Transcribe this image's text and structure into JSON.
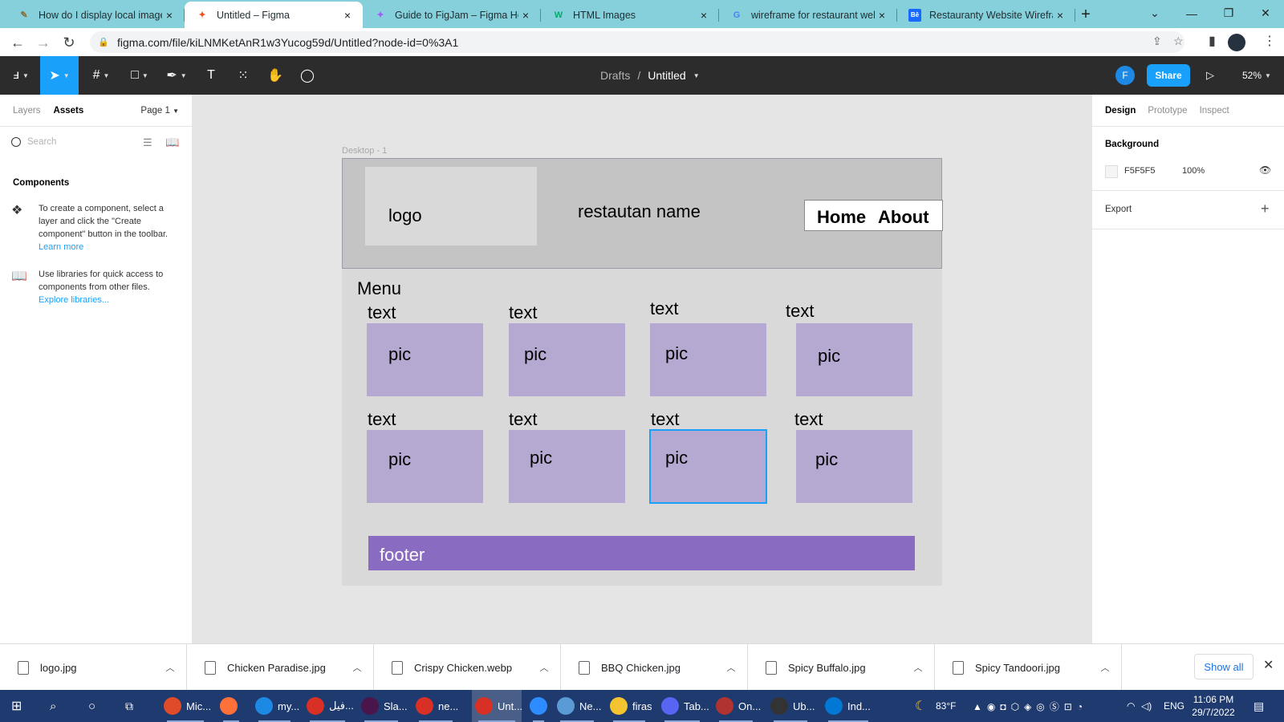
{
  "browser": {
    "tabs": [
      {
        "title": "How do I display local image",
        "favicon": "doc-icon"
      },
      {
        "title": "Untitled – Figma",
        "favicon": "figma-icon",
        "active": true
      },
      {
        "title": "Guide to FigJam – Figma Help",
        "favicon": "figma-icon"
      },
      {
        "title": "HTML Images",
        "favicon": "w3schools-icon"
      },
      {
        "title": "wireframe for restaurant web",
        "favicon": "google-icon"
      },
      {
        "title": "Restauranty Website Wirefran",
        "favicon": "behance-icon"
      }
    ],
    "url": "figma.com/file/kiLNMKetAnR1w3Yucog59d/Untitled?node-id=0%3A1"
  },
  "figma_toolbar": {
    "breadcrumb_parent": "Drafts",
    "breadcrumb_sep": "/",
    "file_name": "Untitled",
    "avatar_letter": "F",
    "share_label": "Share",
    "zoom": "52%"
  },
  "left_panel": {
    "tabs": [
      "Layers",
      "Assets"
    ],
    "active_tab": "Assets",
    "page_selector": "Page 1",
    "search_placeholder": "Search",
    "components_heading": "Components",
    "info1": "To create a component, select a layer and click the \"Create component\" button in the toolbar.",
    "info1_link": "Learn more",
    "info2": "Use libraries for quick access to components from other files.",
    "info2_link": "Explore libraries..."
  },
  "canvas": {
    "frame_label": "Desktop - 1",
    "logo": "logo",
    "restaurant_name": "restautan name",
    "nav": [
      "Home",
      "About"
    ],
    "menu_heading": "Menu",
    "item_text": [
      "text",
      "text",
      "text",
      "text",
      "text",
      "text",
      "text",
      "text"
    ],
    "item_pic": [
      "pic",
      "pic",
      "pic",
      "pic",
      "pic",
      "pic",
      "pic",
      "pic"
    ],
    "footer": "footer",
    "help": "?"
  },
  "right_panel": {
    "tabs": [
      "Design",
      "Prototype",
      "Inspect"
    ],
    "active_tab": "Design",
    "background_title": "Background",
    "bg_hex": "F5F5F5",
    "bg_opacity": "100%",
    "export_title": "Export"
  },
  "downloads": {
    "files": [
      "logo.jpg",
      "Chicken Paradise.jpg",
      "Crispy Chicken.webp",
      "BBQ Chicken.jpg",
      "Spicy Buffalo.jpg",
      "Spicy Tandoori.jpg"
    ],
    "show_all": "Show all"
  },
  "taskbar": {
    "apps": [
      {
        "label": "Mic...",
        "color": "#e04b2a"
      },
      {
        "label": "",
        "color": "#ff7139"
      },
      {
        "label": "my...",
        "color": "#1e88e5"
      },
      {
        "label": "فيل...",
        "color": "#d93025"
      },
      {
        "label": "Sla...",
        "color": "#4a154b"
      },
      {
        "label": "ne...",
        "color": "#d93025"
      },
      {
        "label": "Unt...",
        "color": "#d93025"
      },
      {
        "label": "",
        "color": "#2d8cff"
      },
      {
        "label": "Ne...",
        "color": "#5b9bd5"
      },
      {
        "label": "firas",
        "color": "#f4c430"
      },
      {
        "label": "Tab...",
        "color": "#5865f2"
      },
      {
        "label": "On...",
        "color": "#b0332f"
      },
      {
        "label": "Ub...",
        "color": "#333333"
      },
      {
        "label": "Ind...",
        "color": "#0078d4"
      }
    ],
    "weather": "83°F",
    "lang": "ENG",
    "time": "11:06 PM",
    "date": "29/7/2022"
  }
}
